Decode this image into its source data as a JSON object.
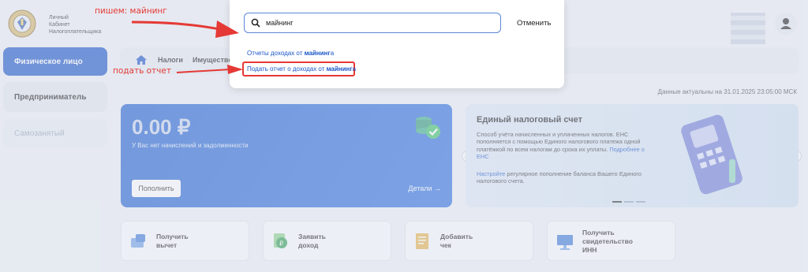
{
  "header": {
    "logo_text": [
      "Личный",
      "Кабинет",
      "Налогоплательщика"
    ]
  },
  "sidebar": {
    "items": [
      {
        "label": "Физическое лицо"
      },
      {
        "label": "Предприниматель"
      },
      {
        "label": "Самозанятый"
      }
    ]
  },
  "topnav": {
    "items": [
      "Налоги",
      "Имущество"
    ]
  },
  "data_note": "Данные актуальны на 31.01.2025 23:05:00 МСК",
  "balance_card": {
    "amount_main": "0",
    "amount_dec": ".00 ₽",
    "subtitle": "У Вас нет начислений и задолженности",
    "pay_button": "Пополнить",
    "details_link": "Детали →"
  },
  "ens_card": {
    "title": "Единый налоговый счет",
    "text_1": "Способ учёта начисленных и уплаченных налогов. ЕНС пополняется с помощью Единого налогового платежа одной платёжкой по всем налогам до срока их уплаты. ",
    "text_1_link": "Подробнее о ЕНС",
    "text_2_link": "Настройте",
    "text_2": " регулярное пополнение баланса Вашего Единого налогового счета."
  },
  "actions": [
    {
      "label_1": "Получить",
      "label_2": "вычет"
    },
    {
      "label_1": "Заявить",
      "label_2": "доход"
    },
    {
      "label_1": "Добавить",
      "label_2": "чек"
    },
    {
      "label_1": "Получить",
      "label_2": "свидетельство",
      "label_3": "ИНН"
    }
  ],
  "search": {
    "value": "майнинг",
    "cancel_label": "Отменить",
    "suggestions": [
      {
        "prefix": "Отчеты доходах от ",
        "match": "майнинг",
        "suffix": "а"
      },
      {
        "prefix": "Подать отчет о доходах от ",
        "match": "майнинг",
        "suffix": "а"
      }
    ]
  },
  "annotations": {
    "top": "пишем: майнинг",
    "left": "подать отчет"
  },
  "colors": {
    "primary": "#1a55c8",
    "annotation": "#e53935"
  }
}
